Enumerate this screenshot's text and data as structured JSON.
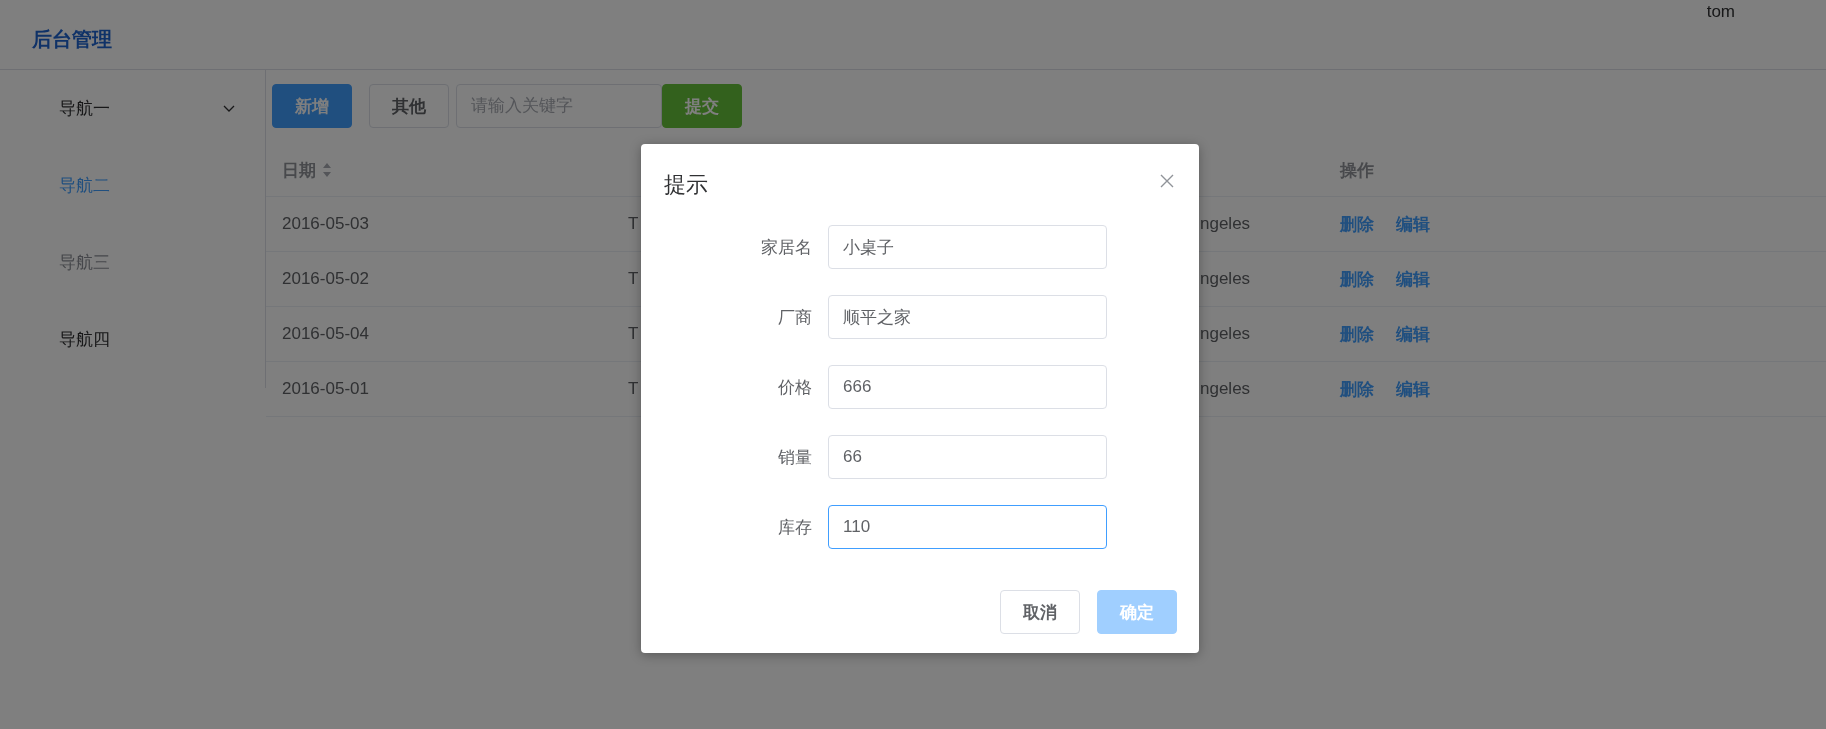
{
  "header": {
    "title": "后台管理",
    "user": "tom"
  },
  "sidebar": {
    "items": [
      {
        "label": "导航一",
        "selected": false,
        "disabled": false,
        "has_submenu": true
      },
      {
        "label": "导航二",
        "selected": true,
        "disabled": false,
        "has_submenu": false
      },
      {
        "label": "导航三",
        "selected": false,
        "disabled": true,
        "has_submenu": false
      },
      {
        "label": "导航四",
        "selected": false,
        "disabled": false,
        "has_submenu": false
      }
    ]
  },
  "toolbar": {
    "buttons": [
      {
        "label": "新增",
        "kind": "primary"
      },
      {
        "label": "其他",
        "kind": "default"
      }
    ],
    "search": {
      "placeholder": "请输入关键字"
    },
    "submit": {
      "label": "提交",
      "kind": "success"
    }
  },
  "table": {
    "columns": [
      {
        "label": "日期"
      },
      {
        "label": "操作"
      }
    ],
    "rows": [
      {
        "date": "2016-05-03",
        "column_2": "T",
        "column_3": "ngeles",
        "actions": [
          "删除",
          "编辑"
        ]
      },
      {
        "date": "2016-05-02",
        "column_2": "T",
        "column_3": "ngeles",
        "actions": [
          "删除",
          "编辑"
        ]
      },
      {
        "date": "2016-05-04",
        "column_2": "T",
        "column_3": "ngeles",
        "actions": [
          "删除",
          "编辑"
        ]
      },
      {
        "date": "2016-05-01",
        "column_2": "T",
        "column_3": "ngeles",
        "actions": [
          "删除",
          "编辑"
        ]
      }
    ]
  },
  "dialog": {
    "title": "提示",
    "fields": [
      {
        "label": "家居名",
        "value": "小桌子",
        "focused": false
      },
      {
        "label": "厂商",
        "value": "顺平之家",
        "focused": false
      },
      {
        "label": "价格",
        "value": "666",
        "focused": false
      },
      {
        "label": "销量",
        "value": "66",
        "focused": false
      },
      {
        "label": "库存",
        "value": "110",
        "focused": true
      }
    ],
    "buttons": [
      {
        "label": "取消",
        "kind": "default",
        "disabled": false
      },
      {
        "label": "确定",
        "kind": "primary",
        "disabled": true
      }
    ]
  }
}
